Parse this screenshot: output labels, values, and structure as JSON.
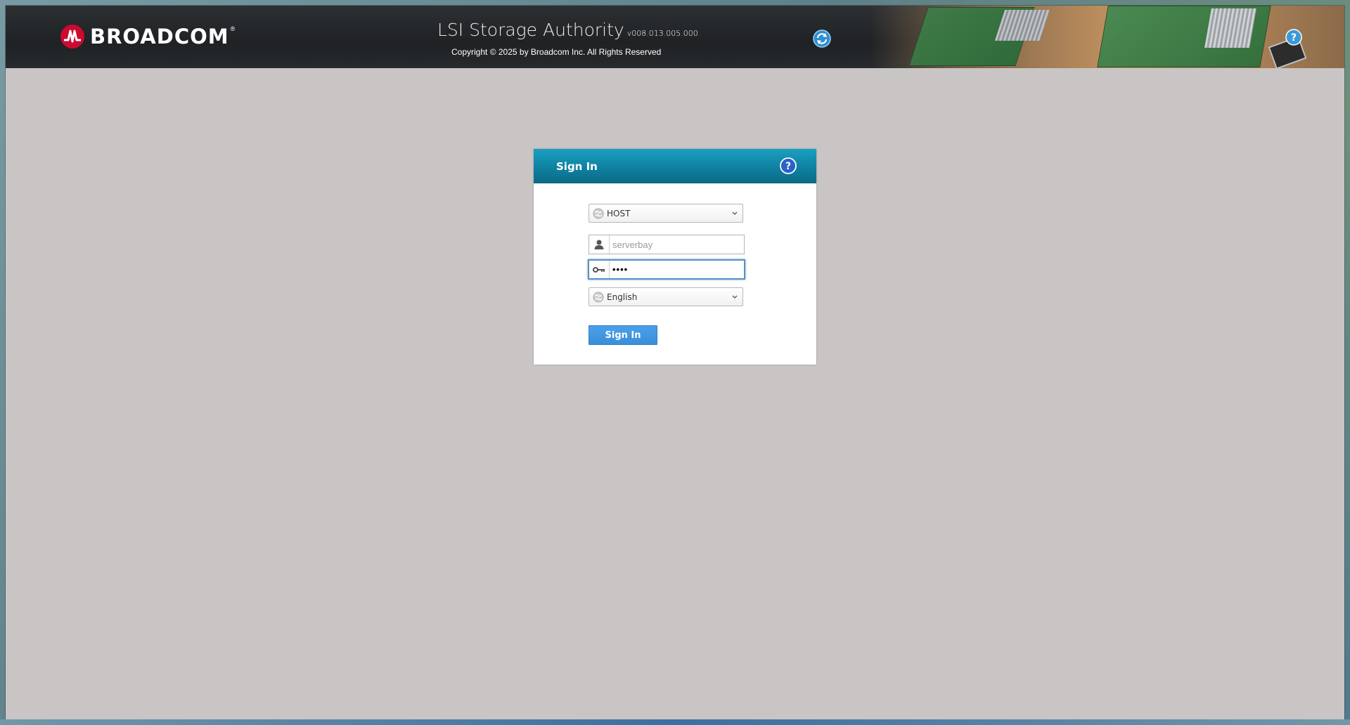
{
  "header": {
    "logo_text": "BROADCOM",
    "logo_reg": "®",
    "app_title": "LSI Storage Authority",
    "app_version": "v008.013.005.000",
    "copyright": "Copyright © 2025 by Broadcom Inc. All Rights Reserved"
  },
  "login": {
    "title": "Sign In",
    "host": {
      "selected": "HOST"
    },
    "username": {
      "value": "",
      "placeholder": "serverbay"
    },
    "password": {
      "value": "••••"
    },
    "language": {
      "selected": "English"
    },
    "submit_label": "Sign In"
  },
  "colors": {
    "brand_red": "#cc092f",
    "panel_header": "#0f7f9e",
    "button_blue": "#3a8fd8",
    "page_bg": "#c9c5c4"
  },
  "icons": [
    "broadcom-logo-icon",
    "refresh-icon",
    "help-icon",
    "globe-icon",
    "user-icon",
    "key-icon",
    "chevron-down-icon"
  ]
}
